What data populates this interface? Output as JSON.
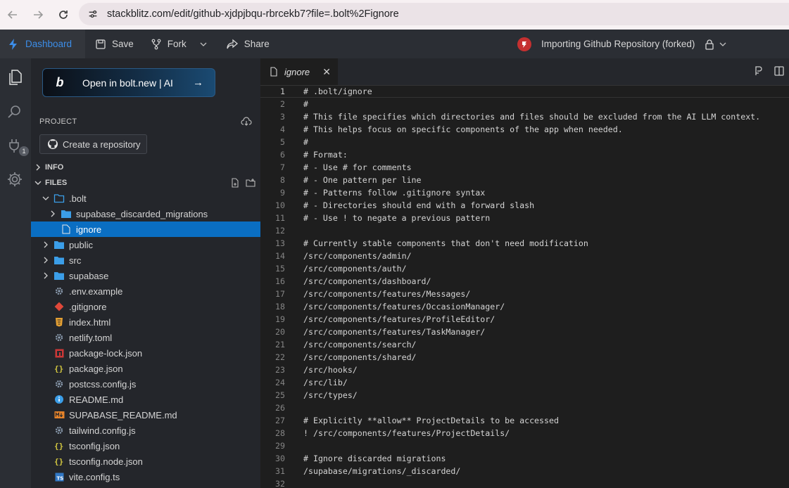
{
  "browser": {
    "url": "stackblitz.com/edit/github-xjdpjbqu-rbrcekb7?file=.bolt%2Fignore"
  },
  "header": {
    "dashboard": "Dashboard",
    "save": "Save",
    "fork": "Fork",
    "share": "Share",
    "status": "Importing Github Repository (forked)"
  },
  "activity": {
    "badge": "1"
  },
  "sidebar": {
    "bolt_button": "Open in bolt.new | AI",
    "project_label": "PROJECT",
    "create_repo": "Create a repository",
    "info_label": "INFO",
    "files_label": "FILES",
    "tree": [
      {
        "name": ".bolt",
        "type": "folder",
        "depth": 1,
        "expanded": true
      },
      {
        "name": "supabase_discarded_migrations",
        "type": "folder",
        "depth": 2,
        "expanded": false
      },
      {
        "name": "ignore",
        "type": "file",
        "depth": 2,
        "icon": "file",
        "selected": true
      },
      {
        "name": "public",
        "type": "folder",
        "depth": 1,
        "expanded": false
      },
      {
        "name": "src",
        "type": "folder",
        "depth": 1,
        "expanded": false
      },
      {
        "name": "supabase",
        "type": "folder",
        "depth": 1,
        "expanded": false
      },
      {
        "name": ".env.example",
        "type": "file",
        "depth": 1,
        "icon": "gear"
      },
      {
        "name": ".gitignore",
        "type": "file",
        "depth": 1,
        "icon": "git"
      },
      {
        "name": "index.html",
        "type": "file",
        "depth": 1,
        "icon": "html"
      },
      {
        "name": "netlify.toml",
        "type": "file",
        "depth": 1,
        "icon": "gear"
      },
      {
        "name": "package-lock.json",
        "type": "file",
        "depth": 1,
        "icon": "npm"
      },
      {
        "name": "package.json",
        "type": "file",
        "depth": 1,
        "icon": "json"
      },
      {
        "name": "postcss.config.js",
        "type": "file",
        "depth": 1,
        "icon": "gear"
      },
      {
        "name": "README.md",
        "type": "file",
        "depth": 1,
        "icon": "info"
      },
      {
        "name": "SUPABASE_README.md",
        "type": "file",
        "depth": 1,
        "icon": "markdown"
      },
      {
        "name": "tailwind.config.js",
        "type": "file",
        "depth": 1,
        "icon": "gear"
      },
      {
        "name": "tsconfig.json",
        "type": "file",
        "depth": 1,
        "icon": "json"
      },
      {
        "name": "tsconfig.node.json",
        "type": "file",
        "depth": 1,
        "icon": "json"
      },
      {
        "name": "vite.config.ts",
        "type": "file",
        "depth": 1,
        "icon": "ts"
      }
    ]
  },
  "editor": {
    "tab_label": "ignore",
    "current_line": 1,
    "lines": [
      "# .bolt/ignore",
      "#",
      "# This file specifies which directories and files should be excluded from the AI LLM context.",
      "# This helps focus on specific components of the app when needed.",
      "#",
      "# Format:",
      "# - Use # for comments",
      "# - One pattern per line",
      "# - Patterns follow .gitignore syntax",
      "# - Directories should end with a forward slash",
      "# - Use ! to negate a previous pattern",
      "",
      "# Currently stable components that don't need modification",
      "/src/components/admin/",
      "/src/components/auth/",
      "/src/components/dashboard/",
      "/src/components/features/Messages/",
      "/src/components/features/OccasionManager/",
      "/src/components/features/ProfileEditor/",
      "/src/components/features/TaskManager/",
      "/src/components/search/",
      "/src/components/shared/",
      "/src/hooks/",
      "/src/lib/",
      "/src/types/",
      "",
      "# Explicitly **allow** ProjectDetails to be accessed",
      "! /src/components/features/ProjectDetails/",
      "",
      "# Ignore discarded migrations",
      "/supabase/migrations/_discarded/",
      ""
    ]
  },
  "colors": {
    "accent": "#0a6ec2",
    "folder": "#3b9ee8",
    "dashboard": "#3c8de8"
  }
}
